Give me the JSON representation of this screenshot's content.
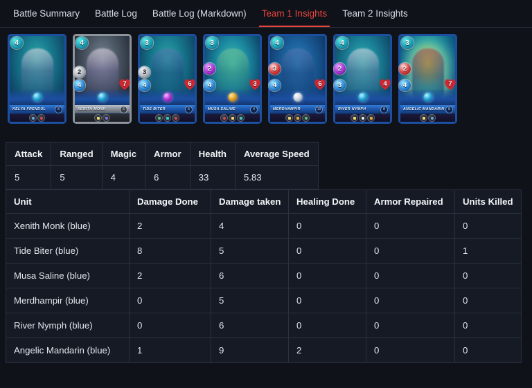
{
  "tabs": [
    {
      "label": "Battle Summary",
      "active": false
    },
    {
      "label": "Battle Log",
      "active": false
    },
    {
      "label": "Battle Log (Markdown)",
      "active": false
    },
    {
      "label": "Team 1 Insights",
      "active": true
    },
    {
      "label": "Team 2 Insights",
      "active": false
    }
  ],
  "accent_color": "#e8453c",
  "background_color": "#0f1219",
  "cards": [
    {
      "name": "KELYA FRENDUL",
      "level": "8",
      "mana": "4",
      "melee": "",
      "magic": "",
      "ranged": "",
      "speed": "",
      "health": "",
      "frame": "blue",
      "abilities": 2
    },
    {
      "name": "XENITH MONK",
      "level": "6",
      "mana": "4",
      "melee": "2",
      "magic": "",
      "ranged": "",
      "speed": "4",
      "health": "7",
      "frame": "gold",
      "abilities": 2
    },
    {
      "name": "TIDE BITER",
      "level": "6",
      "mana": "3",
      "melee": "3",
      "magic": "",
      "ranged": "",
      "speed": "4",
      "health": "6",
      "frame": "blue",
      "abilities": 3
    },
    {
      "name": "MUSA SALINE",
      "level": "4",
      "mana": "3",
      "melee": "",
      "magic": "2",
      "ranged": "",
      "speed": "4",
      "health": "3",
      "frame": "blue",
      "abilities": 3
    },
    {
      "name": "MERDHAMPIR",
      "level": "10",
      "mana": "4",
      "melee": "",
      "magic": "",
      "ranged": "3",
      "speed": "4",
      "health": "6",
      "frame": "blue",
      "abilities": 3
    },
    {
      "name": "RIVER NYMPH",
      "level": "8",
      "mana": "4",
      "melee": "",
      "magic": "2",
      "ranged": "",
      "speed": "3",
      "health": "4",
      "frame": "blue",
      "abilities": 3
    },
    {
      "name": "ANGELIC MANDARIN",
      "level": "8",
      "mana": "3",
      "melee": "",
      "magic": "",
      "ranged": "2",
      "speed": "4",
      "health": "7",
      "frame": "blue",
      "abilities": 2
    }
  ],
  "summary_table": {
    "headers": [
      "Attack",
      "Ranged",
      "Magic",
      "Armor",
      "Health",
      "Average Speed"
    ],
    "values": [
      "5",
      "5",
      "4",
      "6",
      "33",
      "5.83"
    ]
  },
  "units_table": {
    "headers": [
      "Unit",
      "Damage Done",
      "Damage taken",
      "Healing Done",
      "Armor Repaired",
      "Units Killed"
    ],
    "rows": [
      [
        "Xenith Monk (blue)",
        "2",
        "4",
        "0",
        "0",
        "0"
      ],
      [
        "Tide Biter (blue)",
        "8",
        "5",
        "0",
        "0",
        "1"
      ],
      [
        "Musa Saline (blue)",
        "2",
        "6",
        "0",
        "0",
        "0"
      ],
      [
        "Merdhampir (blue)",
        "0",
        "5",
        "0",
        "0",
        "0"
      ],
      [
        "River Nymph (blue)",
        "0",
        "6",
        "0",
        "0",
        "0"
      ],
      [
        "Angelic Mandarin (blue)",
        "1",
        "9",
        "2",
        "0",
        "0"
      ]
    ]
  }
}
